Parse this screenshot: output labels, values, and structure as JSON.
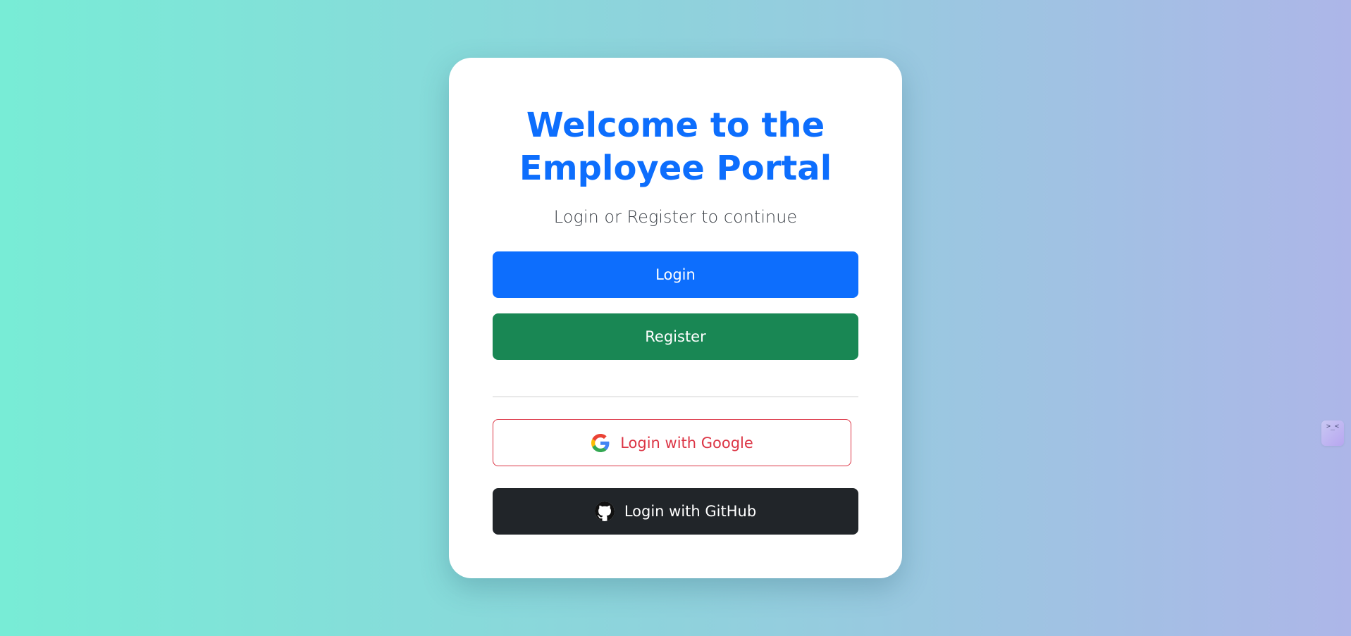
{
  "card": {
    "title_line1": "Welcome to the",
    "title_line2": "Employee Portal",
    "subtitle": "Login or Register to continue"
  },
  "buttons": {
    "login": "Login",
    "register": "Register",
    "google": "Login with Google",
    "github": "Login with GitHub"
  },
  "icons": {
    "google": "google-logo-icon",
    "github": "github-logo-icon",
    "side_widget": "assistant-widget-icon"
  },
  "side_widget": {
    "glyph": ">_<"
  },
  "colors": {
    "primary": "#0d6efd",
    "success": "#198754",
    "danger": "#dc3545",
    "dark": "#212529",
    "gradient_start": "#78ecd6",
    "gradient_end": "#adb6e8"
  }
}
